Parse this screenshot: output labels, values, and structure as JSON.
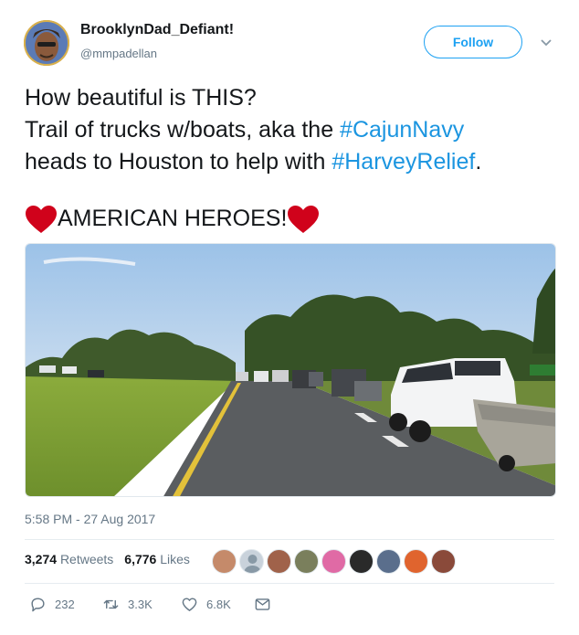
{
  "user": {
    "name": "BrooklynDad_Defiant!",
    "handle": "@mmpadellan"
  },
  "follow_label": "Follow",
  "tweet": {
    "line1": "How beautiful is THIS?",
    "line2_text": "Trail of trucks w/boats, aka the ",
    "hashtag1": "#CajunNavy",
    "line3_text": "heads to Houston to help with ",
    "hashtag2": "#HarveyRelief",
    "line3_end": ".",
    "heroes": "AMERICAN HEROES!"
  },
  "timestamp": "5:58 PM - 27 Aug 2017",
  "stats": {
    "retweets_count": "3,274",
    "retweets_label": "Retweets",
    "likes_count": "6,776",
    "likes_label": "Likes"
  },
  "actions": {
    "replies": "232",
    "retweets": "3.3K",
    "likes": "6.8K"
  },
  "colors": {
    "accent": "#1da1f2",
    "hashtag": "#1b95e0",
    "heart": "#d0021b",
    "muted": "#657786"
  },
  "icons": [
    "chevron-down-icon",
    "heart-emoji-icon",
    "reply-icon",
    "retweet-icon",
    "like-icon",
    "direct-message-icon"
  ]
}
